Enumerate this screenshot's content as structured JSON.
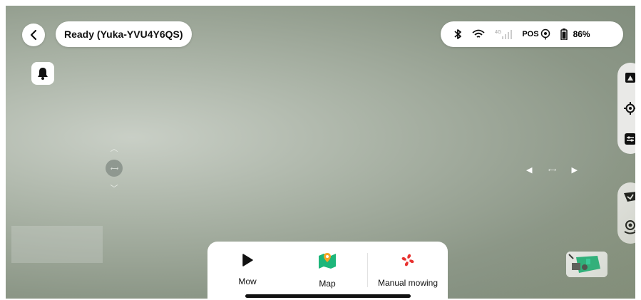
{
  "header": {
    "device_title": "Ready (Yuka-YVU4Y6QS)"
  },
  "status_bar": {
    "signal_label": "4G",
    "pos_label": "POS",
    "battery_percent": "86%"
  },
  "dock": {
    "items": [
      {
        "label": "Mow"
      },
      {
        "label": "Map"
      },
      {
        "label": "Manual mowing"
      }
    ]
  },
  "icons": {
    "back": "chevron-left-icon",
    "bell": "bell-icon",
    "bluetooth": "bluetooth-icon",
    "wifi": "wifi-icon",
    "cellular": "cellular-signal-icon",
    "gps": "gps-icon",
    "battery": "battery-icon",
    "map_view": "map-view-icon",
    "locate": "locate-icon",
    "settings": "sliders-icon",
    "boundary": "boundary-icon",
    "camera_switch": "camera-switch-icon",
    "play": "play-icon",
    "map": "map-pin-icon",
    "fan": "fan-icon"
  },
  "colors": {
    "accent_green": "#1db67a",
    "accent_orange": "#f5a623",
    "accent_red": "#e8312f",
    "camera_bg": "#9aa495"
  }
}
